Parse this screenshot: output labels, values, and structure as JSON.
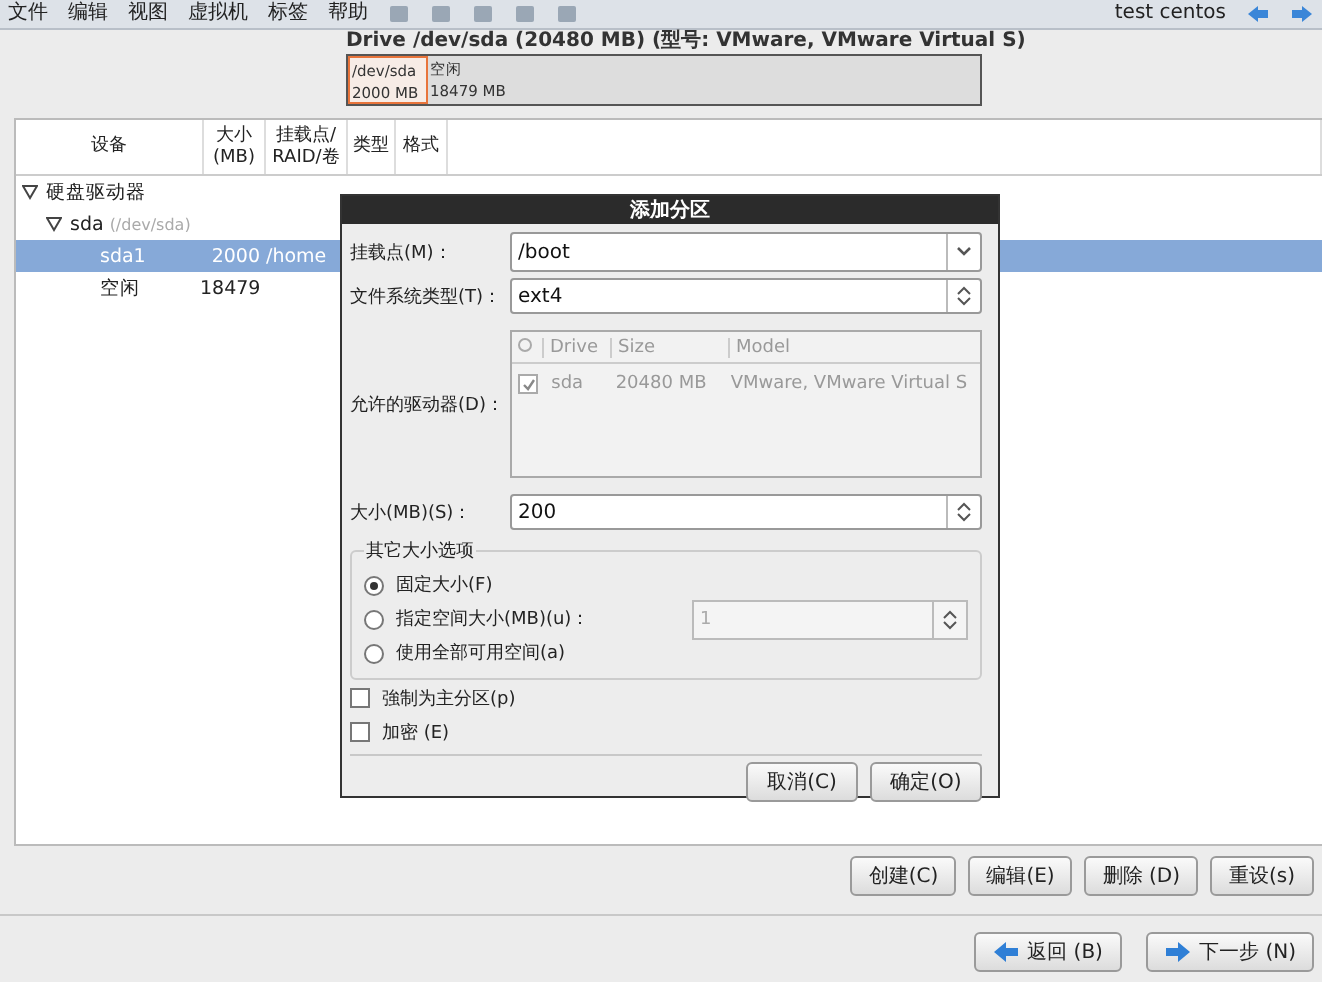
{
  "menu_bar": {
    "items": [
      "文件",
      "编辑",
      "视图",
      "虚拟机",
      "标签",
      "帮助"
    ],
    "user": "test centos"
  },
  "drive_title": "Drive /dev/sda (20480 MB) (型号: VMware, VMware Virtual S)",
  "partition_bar": [
    {
      "name": "/dev/sda",
      "size": "2000 MB",
      "selected": true
    },
    {
      "name": "空闲",
      "size": "18479 MB",
      "selected": false
    }
  ],
  "table": {
    "columns": [
      [
        "设备"
      ],
      [
        "大小",
        "(MB)"
      ],
      [
        "挂载点/",
        "RAID/卷"
      ],
      [
        "类型"
      ],
      [
        "格式"
      ]
    ],
    "rows": [
      {
        "device": "硬盘驱动器",
        "expanded": true,
        "children": [
          {
            "device": "sda",
            "path": "(/dev/sda)",
            "expanded": true,
            "children": [
              {
                "device": "sda1",
                "size": "2000",
                "mount": "/home",
                "selected": true
              },
              {
                "device": "空闲",
                "size": "18479",
                "selected": false
              }
            ]
          }
        ]
      }
    ]
  },
  "dialog": {
    "title": "添加分区",
    "mount_point": {
      "label": "挂载点(M)：",
      "value": "/boot"
    },
    "fs_type": {
      "label": "文件系统类型(T)：",
      "value": "ext4"
    },
    "drives": {
      "label": "允许的驱动器(D)：",
      "disabled": true,
      "columns": [
        "Drive",
        "Size",
        "Model"
      ],
      "rows": [
        {
          "checked": true,
          "drive": "sda",
          "size": "20480 MB",
          "model": "VMware, VMware Virtual S"
        }
      ]
    },
    "size": {
      "label": "大小(MB)(S)：",
      "value": "200"
    },
    "size_options": {
      "title": "其它大小选项",
      "options": [
        {
          "label": "固定大小(F)",
          "selected": true
        },
        {
          "label": "指定空间大小(MB)(u)：",
          "selected": false,
          "spin": "1"
        },
        {
          "label": "使用全部可用空间(a)",
          "selected": false
        }
      ]
    },
    "checkboxes": [
      {
        "label": "強制为主分区(p)",
        "checked": false
      },
      {
        "label": "加密 (E)",
        "checked": false
      }
    ],
    "buttons": [
      "取消(C)",
      "确定(O)"
    ]
  },
  "action_buttons": [
    "创建(C)",
    "编辑(E)",
    "删除 (D)",
    "重设(s)"
  ],
  "nav_buttons": [
    {
      "kind": "back",
      "label": "返回 (B)"
    },
    {
      "kind": "next",
      "label": "下一步 (N)"
    }
  ]
}
